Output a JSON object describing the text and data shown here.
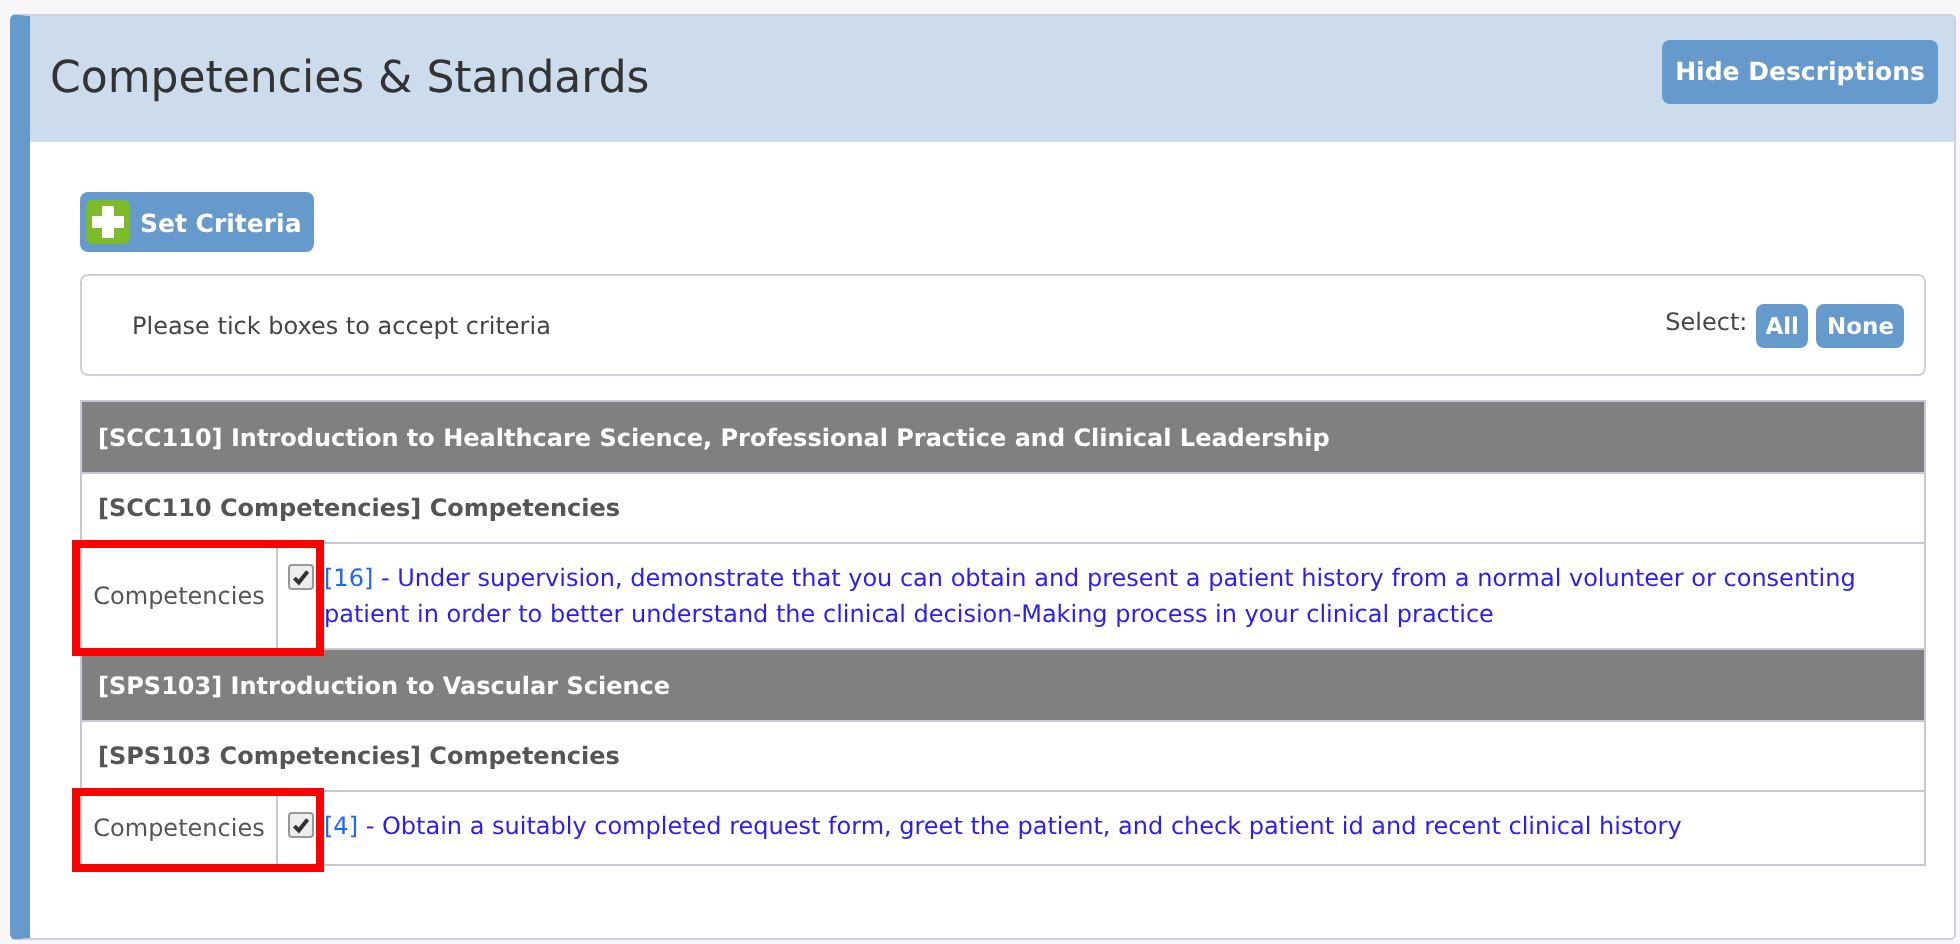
{
  "panel": {
    "title": "Competencies & Standards",
    "header_button": "Hide Descriptions"
  },
  "set_criteria_button": "Set Criteria",
  "instruction": {
    "text": "Please tick boxes to accept criteria",
    "select_label": "Select:",
    "select_buttons": [
      "All",
      "None"
    ]
  },
  "groups": [
    {
      "title": "[SCC110] Introduction to Healthcare Science, Professional Practice and Clinical Leadership",
      "subtitle": "[SCC110 Competencies] Competencies",
      "items": [
        {
          "label": "Competencies",
          "checked": true,
          "highlighted": true,
          "code": "[16]",
          "description": "- Under supervision, demonstrate that you can obtain and present a patient history from a normal volunteer or consenting patient in order to better understand the clinical decision-Making process in your clinical practice"
        }
      ]
    },
    {
      "title": "[SPS103] Introduction to Vascular Science",
      "subtitle": "[SPS103 Competencies] Competencies",
      "items": [
        {
          "label": "Competencies",
          "checked": true,
          "highlighted": true,
          "code": "[4]",
          "description": "- Obtain a suitably completed request form, greet the patient, and check patient id and recent clinical history"
        }
      ]
    }
  ]
}
